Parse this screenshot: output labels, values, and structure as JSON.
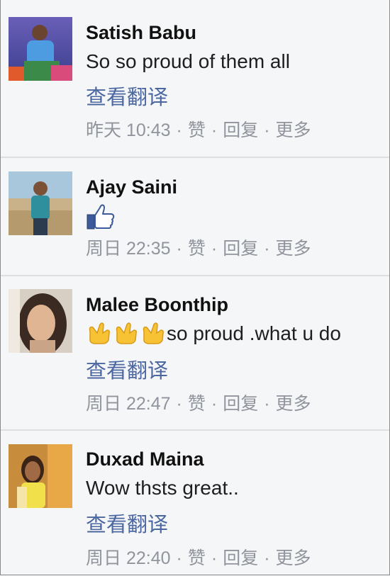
{
  "comments": [
    {
      "name": "Satish Babu",
      "text": "So so proud of them all",
      "translate": "查看翻译",
      "time": "昨天 10:43",
      "sep": "·",
      "like": "赞",
      "reply": "回复",
      "more": "更多"
    },
    {
      "name": "Ajay Saini",
      "time": "周日 22:35",
      "sep": "·",
      "like": "赞",
      "reply": "回复",
      "more": "更多",
      "sticker": "thumbs-up-icon"
    },
    {
      "name": "Malee Boonthip",
      "text": "so proud .what u do",
      "emoji": "pointing-hand-icon",
      "emoji_count": 3,
      "translate": "查看翻译",
      "time": "周日 22:47",
      "sep": "·",
      "like": "赞",
      "reply": "回复",
      "more": "更多"
    },
    {
      "name": "Duxad Maina",
      "text": "Wow thsts great..",
      "translate": "查看翻译",
      "time": "周日 22:40",
      "sep": "·",
      "like": "赞",
      "reply": "回复",
      "more": "更多"
    }
  ],
  "colors": {
    "link": "#4b67a1",
    "meta": "#90949c",
    "background": "#f5f6f7"
  }
}
